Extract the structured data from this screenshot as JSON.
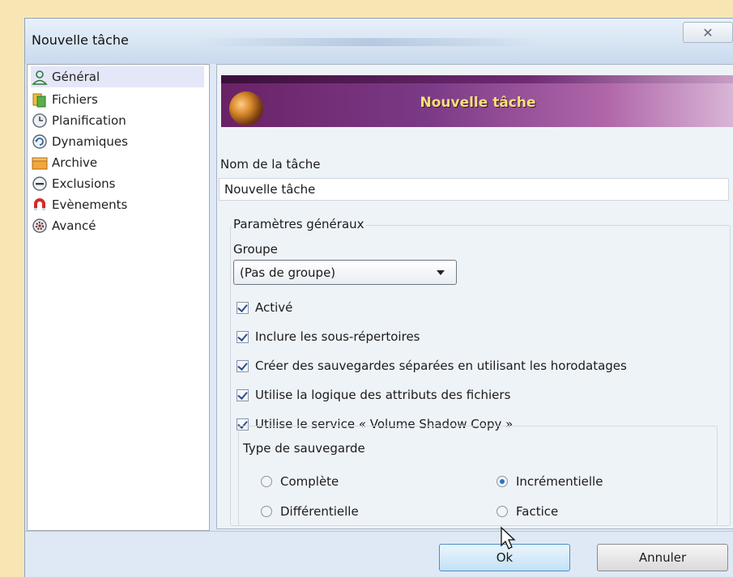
{
  "window": {
    "title": "Nouvelle tâche",
    "close_glyph": "✕"
  },
  "sidebar": {
    "items": [
      {
        "label": "Général",
        "icon": "user-icon",
        "active": true
      },
      {
        "label": "Fichiers",
        "icon": "files-icon"
      },
      {
        "label": "Planification",
        "icon": "clock-icon"
      },
      {
        "label": "Dynamiques",
        "icon": "refresh-icon"
      },
      {
        "label": "Archive",
        "icon": "archive-icon"
      },
      {
        "label": "Exclusions",
        "icon": "minus-circle-icon"
      },
      {
        "label": "Evènements",
        "icon": "magnet-icon"
      },
      {
        "label": "Avancé",
        "icon": "gear-icon"
      }
    ]
  },
  "banner": {
    "title": "Nouvelle tâche"
  },
  "task_name": {
    "label": "Nom de la tâche",
    "value": "Nouvelle tâche"
  },
  "general": {
    "legend": "Paramètres généraux",
    "group_label": "Groupe",
    "group_value": "(Pas de groupe)",
    "checks": [
      {
        "label": "Activé",
        "checked": true
      },
      {
        "label": "Inclure les sous-répertoires",
        "checked": true
      },
      {
        "label": "Créer des sauvegardes séparées en utilisant les horodatages",
        "checked": true
      },
      {
        "label": "Utilise la logique des attributs des fichiers",
        "checked": true
      },
      {
        "label": "Utilise le service « Volume Shadow Copy »",
        "checked": true
      }
    ]
  },
  "backup_type": {
    "legend": "Type de sauvegarde",
    "options": [
      {
        "label": "Complète",
        "selected": false
      },
      {
        "label": "Incrémentielle",
        "selected": true
      },
      {
        "label": "Différentielle",
        "selected": false
      },
      {
        "label": "Factice",
        "selected": false
      }
    ]
  },
  "footer": {
    "ok_label": "Ok",
    "cancel_label": "Annuler"
  },
  "colors": {
    "accent": "#4b8dc7",
    "banner_start": "#6a2266",
    "banner_title": "#f6e07a"
  }
}
